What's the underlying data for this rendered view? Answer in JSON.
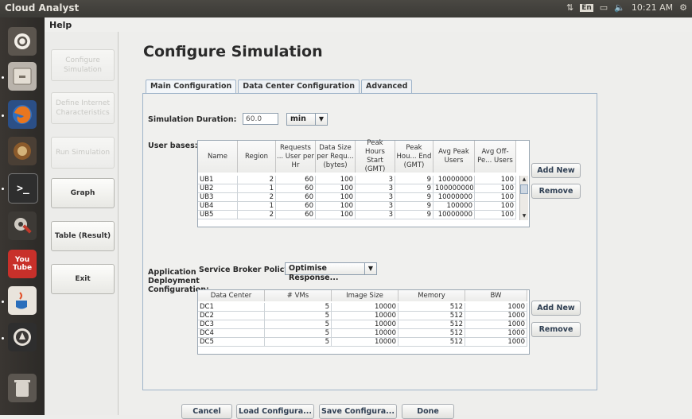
{
  "app": {
    "title": "Cloud Analyst"
  },
  "tray": {
    "kb": "En",
    "time": "10:21 AM"
  },
  "menu": {
    "help": "Help"
  },
  "nav": {
    "configure": "Configure Simulation",
    "define_internet": "Define Internet Characteristics",
    "run": "Run Simulation",
    "graph": "Graph",
    "table": "Table (Result)",
    "exit": "Exit"
  },
  "page": {
    "title": "Configure Simulation"
  },
  "tabs": [
    "Main Configuration",
    "Data Center Configuration",
    "Advanced"
  ],
  "simulation": {
    "label": "Simulation Duration:",
    "value": "60.0",
    "unit": "min"
  },
  "user_bases": {
    "label": "User bases:",
    "columns": [
      "Name",
      "Region",
      "Requests ... User per Hr",
      "Data Size per Requ... (bytes)",
      "Peak Hours Start (GMT)",
      "Peak Hou... End (GMT)",
      "Avg Peak Users",
      "Avg Off-Pe... Users"
    ],
    "rows": [
      [
        "UB1",
        "2",
        "60",
        "100",
        "3",
        "9",
        "10000000",
        "100"
      ],
      [
        "UB2",
        "1",
        "60",
        "100",
        "3",
        "9",
        "100000000",
        "100"
      ],
      [
        "UB3",
        "2",
        "60",
        "100",
        "3",
        "9",
        "10000000",
        "100"
      ],
      [
        "UB4",
        "1",
        "60",
        "100",
        "3",
        "9",
        "100000",
        "100"
      ],
      [
        "UB5",
        "2",
        "60",
        "100",
        "3",
        "9",
        "10000000",
        "100"
      ]
    ],
    "add_new": "Add New",
    "remove": "Remove"
  },
  "deployment": {
    "label_lines": [
      "Application",
      "Deployment",
      "Configuration:"
    ],
    "broker_label": "Service Broker Policy:",
    "broker_value": "Optimise Response...",
    "columns": [
      "Data Center",
      "# VMs",
      "Image Size",
      "Memory",
      "BW"
    ],
    "rows": [
      [
        "DC1",
        "5",
        "10000",
        "512",
        "1000"
      ],
      [
        "DC2",
        "5",
        "10000",
        "512",
        "1000"
      ],
      [
        "DC3",
        "5",
        "10000",
        "512",
        "1000"
      ],
      [
        "DC4",
        "5",
        "10000",
        "512",
        "1000"
      ],
      [
        "DC5",
        "5",
        "10000",
        "512",
        "1000"
      ]
    ],
    "add_new": "Add New",
    "remove": "Remove"
  },
  "footer": {
    "cancel": "Cancel",
    "load": "Load Configura...",
    "save": "Save Configura...",
    "done": "Done"
  }
}
